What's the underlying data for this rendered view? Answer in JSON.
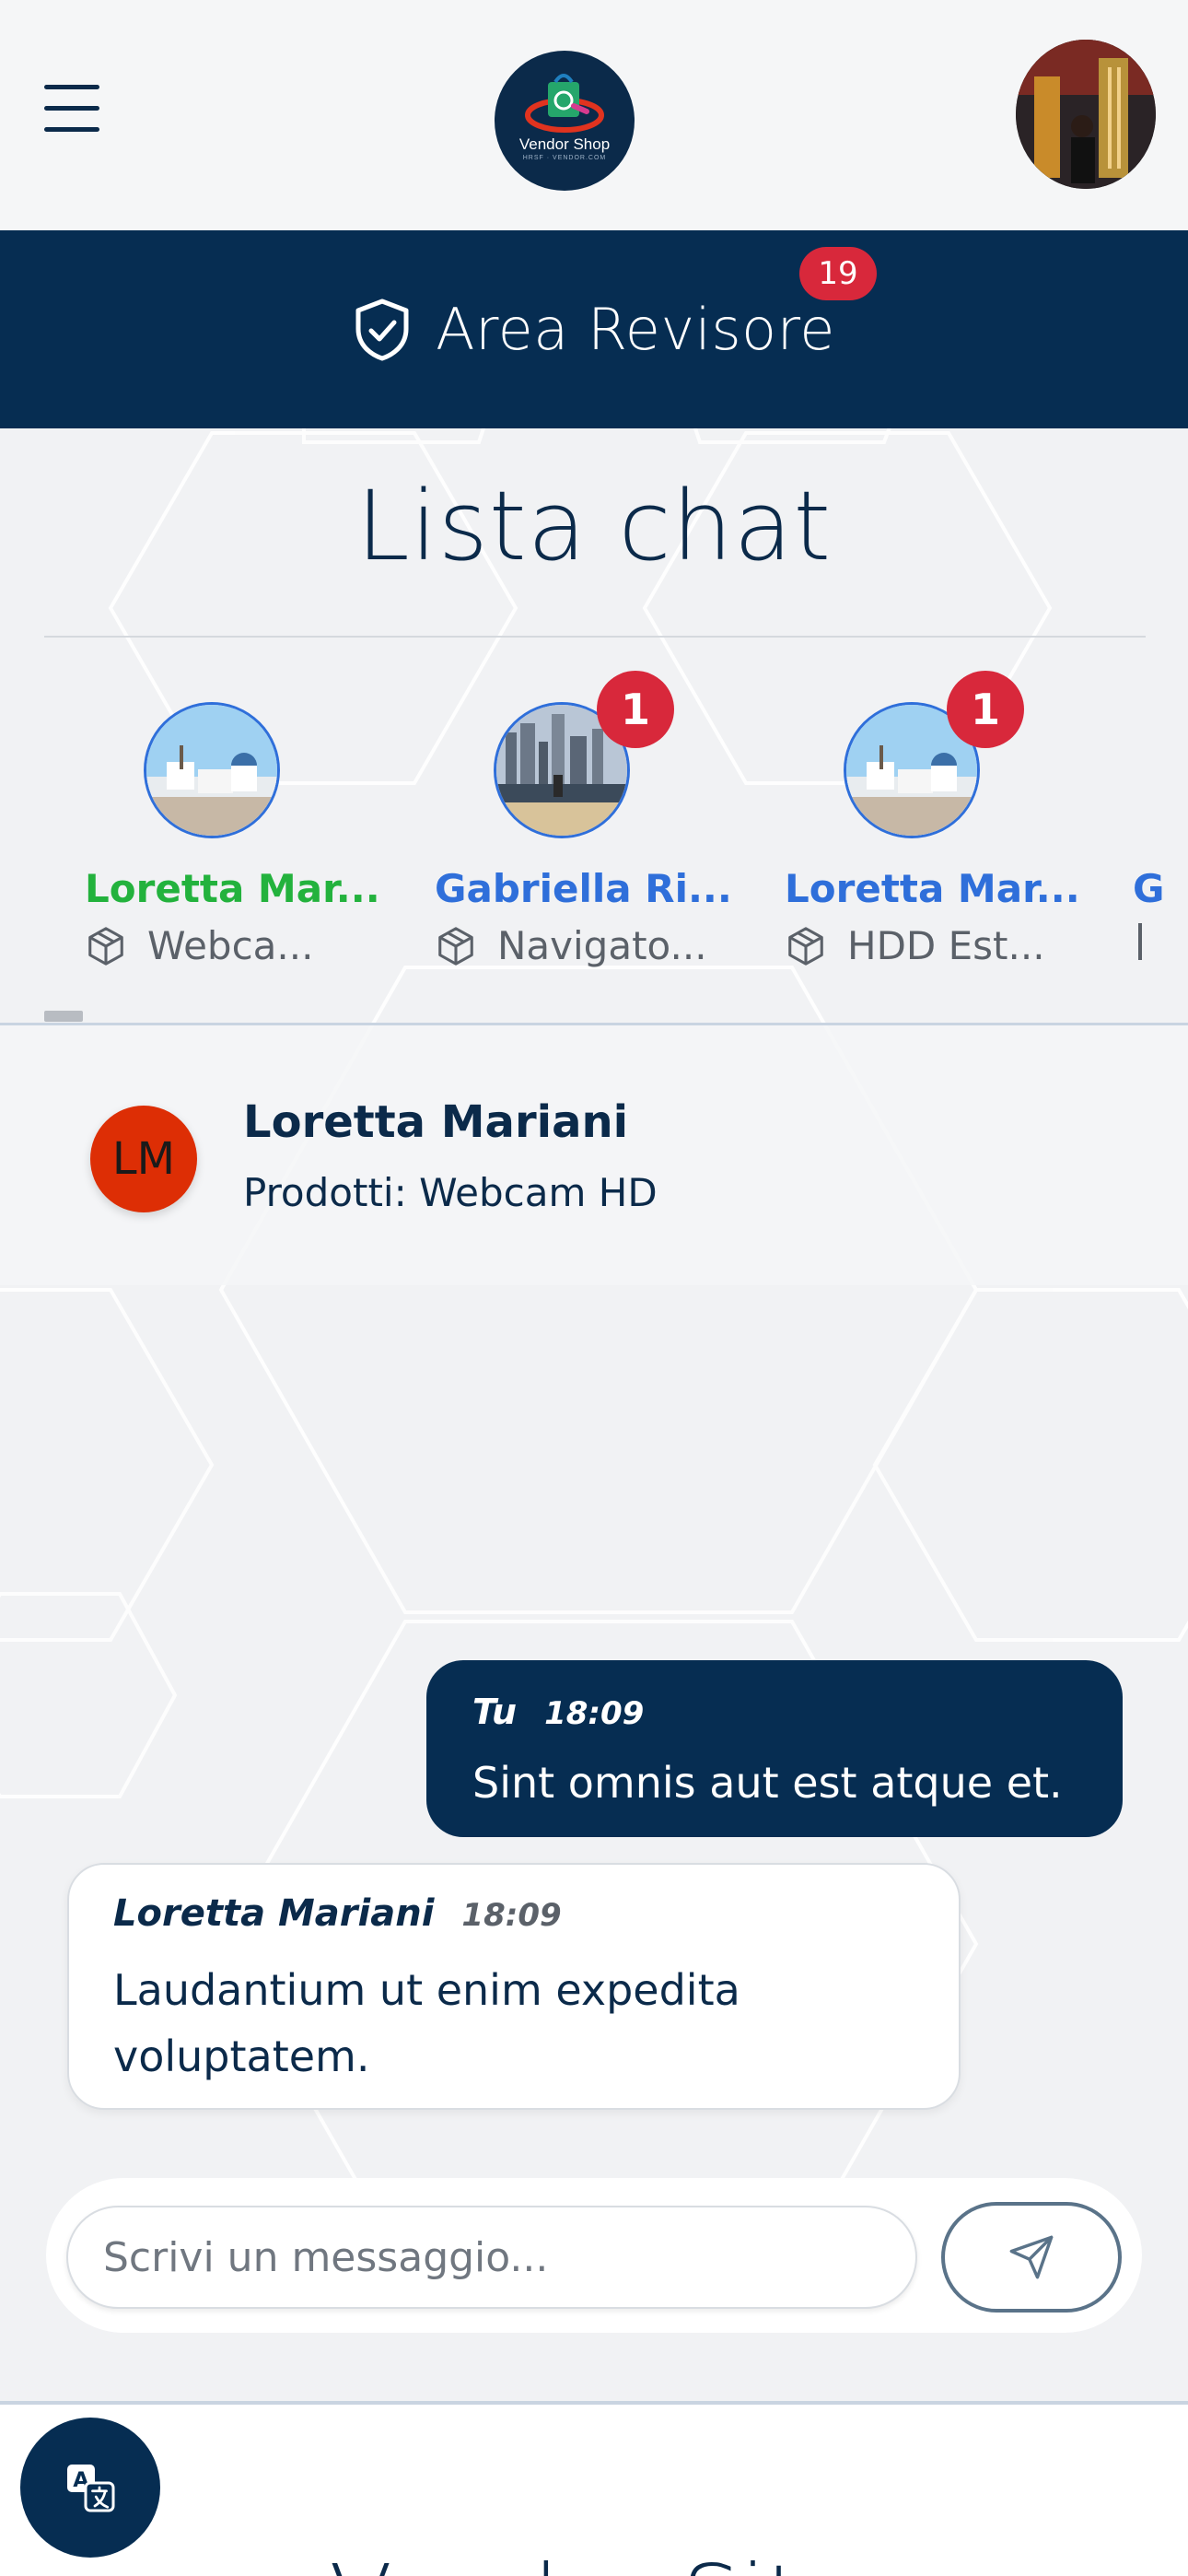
{
  "header": {
    "logo_text": "Vendor Shop",
    "logo_sub": "HRSF · VENDOR.COM"
  },
  "banner": {
    "title": "Area Revisore",
    "badge_count": "19"
  },
  "chat_list": {
    "title": "Lista chat",
    "contacts": [
      {
        "name": "Loretta Mar...",
        "product": "Webca...",
        "unread": "",
        "name_color": "#23b23d"
      },
      {
        "name": "Gabriella Ri...",
        "product": "Navigato...",
        "unread": "1",
        "name_color": "#2f6fda"
      },
      {
        "name": "Loretta Mar...",
        "product": "HDD Est...",
        "unread": "1",
        "name_color": "#2f6fda"
      }
    ],
    "partial_initial": "G"
  },
  "active_chat": {
    "initials": "LM",
    "name": "Loretta Mariani",
    "products": "Prodotti: Webcam HD"
  },
  "messages": [
    {
      "author": "Tu",
      "time": "18:09",
      "text": "Sint omnis aut est atque et.",
      "direction": "out"
    },
    {
      "author": "Loretta Mariani",
      "time": "18:09",
      "text": "Laudantium ut enim expedita voluptatem.",
      "direction": "in"
    }
  ],
  "composer": {
    "placeholder": "Scrivi un messaggio..."
  },
  "footer": {
    "brand": "Vendor Site"
  },
  "colors": {
    "navy": "#062d52",
    "accent_red": "#d8283b",
    "green": "#23b23d",
    "blue": "#2f6fda",
    "avatar_red": "#dd2e05"
  },
  "icons": {
    "menu": "hamburger-icon",
    "shield": "shield-check-icon",
    "product": "box-icon",
    "send": "paper-plane-icon",
    "translate": "translate-icon"
  }
}
